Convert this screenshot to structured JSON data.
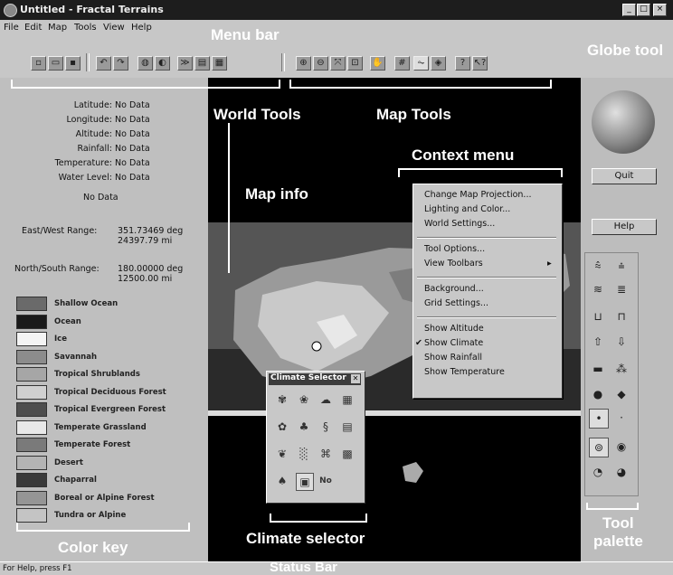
{
  "window": {
    "title": "Untitled - Fractal Terrains"
  },
  "menu": [
    "File",
    "Edit",
    "Map",
    "Tools",
    "View",
    "Help"
  ],
  "toolbar": {
    "world_tools": [
      "new-document-icon",
      "open-folder-icon",
      "save-icon",
      "undo-icon",
      "redo-icon",
      "globe-icon",
      "globe-icon",
      "brush-icon",
      "grid-icon",
      "palette-icon"
    ],
    "map_tools": [
      "zoom-in-icon",
      "zoom-out-icon",
      "zoom-fit-icon",
      "zoom-rect-icon",
      "hand-icon",
      "grid-toggle-icon",
      "scan-icon",
      "layers-icon",
      "help-icon",
      "context-help-icon"
    ]
  },
  "map_info": {
    "rows": [
      {
        "label": "Latitude:",
        "value": "No Data"
      },
      {
        "label": "Longitude:",
        "value": "No Data"
      },
      {
        "label": "Altitude:",
        "value": "No Data"
      },
      {
        "label": "Rainfall:",
        "value": "No Data"
      },
      {
        "label": "Temperature:",
        "value": "No Data"
      },
      {
        "label": "Water Level:",
        "value": "No Data"
      }
    ],
    "no_data": "No Data",
    "ew_label": "East/West Range:",
    "ew_deg": "351.73469 deg",
    "ew_mi": "24397.79 mi",
    "ns_label": "North/South Range:",
    "ns_deg": "180.00000 deg",
    "ns_mi": "12500.00 mi"
  },
  "color_key": [
    {
      "label": "Shallow Ocean",
      "color": "#6a6a6a"
    },
    {
      "label": "Ocean",
      "color": "#1a1a1a"
    },
    {
      "label": "Ice",
      "color": "#f4f4f4"
    },
    {
      "label": "Savannah",
      "color": "#8c8c8c"
    },
    {
      "label": "Tropical Shrublands",
      "color": "#a6a6a6"
    },
    {
      "label": "Tropical Deciduous Forest",
      "color": "#d0d0d0"
    },
    {
      "label": "Tropical Evergreen Forest",
      "color": "#4e4e4e"
    },
    {
      "label": "Temperate Grassland",
      "color": "#e8e8e8"
    },
    {
      "label": "Temperate Forest",
      "color": "#7a7a7a"
    },
    {
      "label": "Desert",
      "color": "#b4b4b4"
    },
    {
      "label": "Chaparral",
      "color": "#3a3a3a"
    },
    {
      "label": "Boreal or Alpine Forest",
      "color": "#959595"
    },
    {
      "label": "Tundra or Alpine",
      "color": "#c4c4c4"
    }
  ],
  "context_menu": {
    "group1": [
      "Change Map Projection...",
      "Lighting and Color...",
      "World Settings..."
    ],
    "group2": [
      "Tool Options...",
      "View Toolbars"
    ],
    "group3": [
      "Background...",
      "Grid Settings..."
    ],
    "group4": [
      "Show Altitude",
      "Show Climate",
      "Show Rainfall",
      "Show Temperature"
    ],
    "checked": "Show Climate"
  },
  "climate_selector": {
    "title": "Climate Selector",
    "close": "✕",
    "tools": [
      "cs-1",
      "cs-2",
      "cs-3",
      "cs-4",
      "cs-5",
      "cs-6",
      "cs-7",
      "cs-8",
      "cs-9",
      "cs-10",
      "cs-11",
      "cs-12"
    ],
    "no_label": "No"
  },
  "right_panel": {
    "quit": "Quit",
    "help": "Help"
  },
  "status": {
    "text": "For Help, press F1"
  },
  "callouts": {
    "menu_bar": "Menu bar",
    "globe_tool": "Globe tool",
    "world_tools": "World Tools",
    "map_tools": "Map Tools",
    "context_menu": "Context menu",
    "map_info": "Map info",
    "color_key": "Color key",
    "climate_selector": "Climate selector",
    "tool_palette_1": "Tool",
    "tool_palette_2": "palette",
    "status_bar": "Status Bar"
  }
}
